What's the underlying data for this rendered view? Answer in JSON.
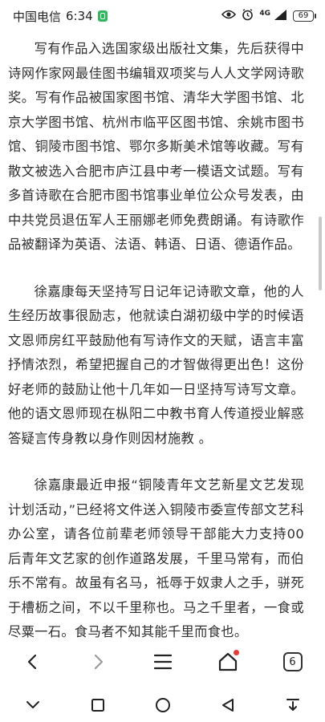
{
  "status_bar": {
    "carrier": "中国电信",
    "time": "6:34",
    "network": "4G",
    "battery": "69"
  },
  "article": {
    "paragraphs": [
      "写有作品入选国家级出版社文集，先后获得中诗网作家网最佳图书编辑双项奖与人人文学网诗歌奖。写有作品被国家图书馆、清华大学图书馆、北京大学图书馆、杭州市临平区图书馆、余姚市图书馆、铜陵市图书馆、鄂尔多斯美术馆等收藏。写有散文被选入合肥市庐江县中考一模语文试题。写有多首诗歌在合肥市图书馆事业单位公众号发表，由中共党员退伍军人王丽娜老师免费朗诵。有诗歌作品被翻译为英语、法语、韩语、日语、德语作品。",
      "徐嘉康每天坚持写日记年记诗歌文章，他的人生经历故事很励志，他就读白湖初级中学的时候语文恩师房红平鼓励他有写诗作文的天赋，语言丰富抒情浓烈，希望把握自己的才智做得更出色！这份好老师的鼓励让他十几年如一日坚持写诗写文章。他的语文恩师现在枞阳二中教书育人传道授业解惑答疑言传身教以身作则因材施教 。",
      "徐嘉康最近申报“铜陵青年文艺新星文艺发现计划活动，”已经将文件送入铜陵市委宣传部文艺科办公室，请各位前辈老师领导干部能大力支持00后青年文艺家的创作道路发展，千里马常有，而伯乐不常有。故虽有名马，祗辱于奴隶人之手，骈死于槽枥之间，不以千里称也。马之千里者，一食或尽粟一石。食马者不知其能千里而食也。"
    ]
  },
  "toolbar": {
    "tab_count": "6"
  }
}
